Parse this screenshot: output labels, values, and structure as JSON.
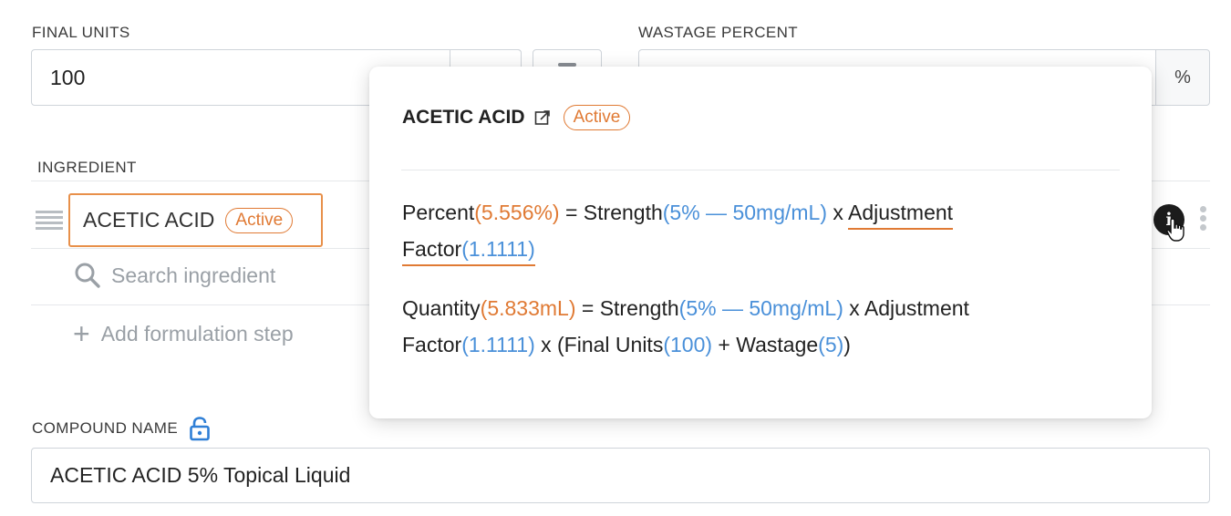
{
  "final_units": {
    "label": "FINAL UNITS",
    "value": "100"
  },
  "wastage": {
    "label": "WASTAGE PERCENT",
    "value": "",
    "suffix": "%"
  },
  "ingredient": {
    "header": "INGREDIENT",
    "name": "ACETIC ACID",
    "badge": "Active"
  },
  "search": {
    "placeholder": "Search ingredient"
  },
  "add_step": {
    "label": "Add formulation step"
  },
  "compound": {
    "label": "COMPOUND NAME",
    "value": "ACETIC ACID 5% Topical Liquid"
  },
  "popover": {
    "title": "ACETIC ACID",
    "badge": "Active",
    "percent_formula": {
      "label": "Percent",
      "value": "(5.556%)",
      "eq": " = Strength",
      "strength": "(5% — 50mg/mL)",
      "x1": " x ",
      "adj_label_1": "Adjustment",
      "adj_label_2": "Factor",
      "adj_value": "(1.1111)"
    },
    "quantity_formula": {
      "label": "Quantity",
      "value": "(5.833mL)",
      "eq": " = Strength",
      "strength": "(5% — 50mg/mL)",
      "x1": " x Adjustment Factor",
      "adj_value": "(1.1111)",
      "x2": " x (Final Units",
      "final_units_value": "(100)",
      "plus": " + Wastage",
      "wastage_value": "(5)",
      "close": ")"
    }
  },
  "colors": {
    "accent_orange": "#e07a34",
    "value_blue": "#4a90d9"
  }
}
